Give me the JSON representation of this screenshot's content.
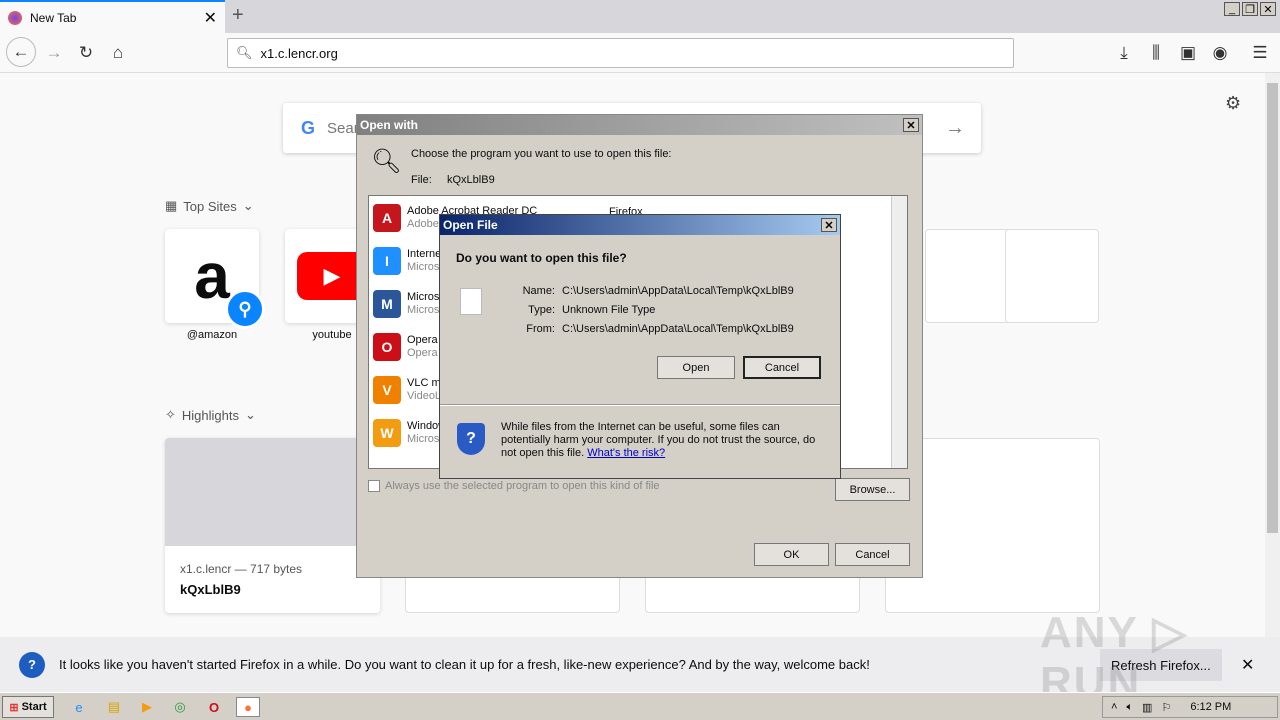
{
  "browser": {
    "tab_title": "New Tab",
    "url": "x1.c.lencr.org",
    "search_placeholder": "Search the Web"
  },
  "newtab": {
    "top_sites_label": "Top Sites",
    "top_sites": [
      {
        "label": "@amazon"
      },
      {
        "label": "youtube"
      }
    ],
    "highlights_label": "Highlights",
    "highlight_card": {
      "source": "x1.c.lencr — 717 bytes",
      "title": "kQxLblB9"
    }
  },
  "open_with": {
    "title": "Open with",
    "prompt": "Choose the program you want to use to open this file:",
    "file_label": "File:",
    "file_name": "kQxLblB9",
    "programs": [
      {
        "name": "Adobe Acrobat Reader DC",
        "publisher": "Adobe",
        "icon": "acrobat-icon",
        "color": "#c4161c"
      },
      {
        "name": "Internet Explorer",
        "publisher": "Microsoft",
        "icon": "ie-icon",
        "color": "#1e90ff"
      },
      {
        "name": "Microsoft Word",
        "publisher": "Microsoft",
        "icon": "word-icon",
        "color": "#2b579a"
      },
      {
        "name": "Opera",
        "publisher": "Opera",
        "icon": "opera-icon",
        "color": "#cc0f16"
      },
      {
        "name": "VLC media player",
        "publisher": "VideoLAN",
        "icon": "vlc-icon",
        "color": "#f08000"
      },
      {
        "name": "Windows Media Player",
        "publisher": "Microsoft",
        "icon": "wmp-icon",
        "color": "#f39c12"
      }
    ],
    "program_right": "Firefox",
    "always_use": "Always use the selected program to open this kind of file",
    "browse": "Browse...",
    "ok": "OK",
    "cancel": "Cancel"
  },
  "open_file": {
    "title": "Open File",
    "question": "Do you want to open this file?",
    "name_label": "Name:",
    "name_value": "C:\\Users\\admin\\AppData\\Local\\Temp\\kQxLblB9",
    "type_label": "Type:",
    "type_value": "Unknown File Type",
    "from_label": "From:",
    "from_value": "C:\\Users\\admin\\AppData\\Local\\Temp\\kQxLblB9",
    "open": "Open",
    "cancel": "Cancel",
    "warning": "While files from the Internet can be useful, some files can potentially harm your computer. If you do not trust the source, do not open this file.",
    "risk_link": "What's the risk?"
  },
  "notification": {
    "text": "It looks like you haven't started Firefox in a while. Do you want to clean it up for a fresh, like-new experience? And by the way, welcome back!",
    "button": "Refresh Firefox..."
  },
  "taskbar": {
    "start": "Start",
    "clock": "6:12 PM"
  },
  "watermark": "ANY RUN"
}
